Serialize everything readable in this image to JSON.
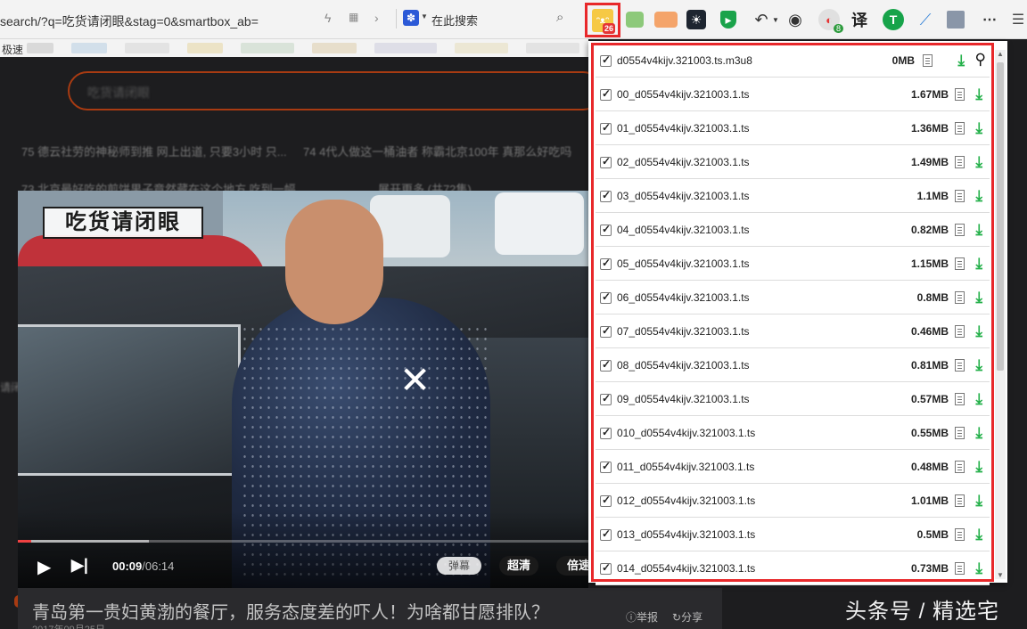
{
  "browser": {
    "url": "search/?q=吃货请闭眼&stag=0&smartbox_ab=",
    "search_placeholder": "在此搜索",
    "bookmark_label": "极速",
    "extension_badge": "26",
    "translate_label": "译",
    "extension_mail_badge": "8"
  },
  "page": {
    "search_value": "吃货请闭眼",
    "news": [
      "75 德云社劳的神秘师到推 网上出道, 只要3小时 只...",
      "74 4代人做这一桶油者 称霸北京100年 真那么好吃吗",
      "73 北京最好吃的煎饼果子竟然藏在这个地方 吃到一幅",
      "展开更多 (共72集)"
    ],
    "side_text": "请闭"
  },
  "video": {
    "logo_text": "吃货请闭眼",
    "current_time": "00:09",
    "duration": "/06:14",
    "played_fraction": 0.024,
    "buffered_fraction": 0.23,
    "danmu_label": "弹幕",
    "quality_label": "超清",
    "speed_label": "倍速"
  },
  "article": {
    "title": "青岛第一贵妇黄渤的餐厅，服务态度差的吓人！为啥都甘愿排队？",
    "date": "2017年09月25日",
    "report_label": "举报",
    "share_label": "分享"
  },
  "watermark": "头条号 / 精选宅",
  "popup": {
    "files": [
      {
        "name": "d0554v4kijv.321003.ts.m3u8",
        "size": "0MB"
      },
      {
        "name": "00_d0554v4kijv.321003.1.ts",
        "size": "1.67MB"
      },
      {
        "name": "01_d0554v4kijv.321003.1.ts",
        "size": "1.36MB"
      },
      {
        "name": "02_d0554v4kijv.321003.1.ts",
        "size": "1.49MB"
      },
      {
        "name": "03_d0554v4kijv.321003.1.ts",
        "size": "1.1MB"
      },
      {
        "name": "04_d0554v4kijv.321003.1.ts",
        "size": "0.82MB"
      },
      {
        "name": "05_d0554v4kijv.321003.1.ts",
        "size": "1.15MB"
      },
      {
        "name": "06_d0554v4kijv.321003.1.ts",
        "size": "0.8MB"
      },
      {
        "name": "07_d0554v4kijv.321003.1.ts",
        "size": "0.46MB"
      },
      {
        "name": "08_d0554v4kijv.321003.1.ts",
        "size": "0.81MB"
      },
      {
        "name": "09_d0554v4kijv.321003.1.ts",
        "size": "0.57MB"
      },
      {
        "name": "010_d0554v4kijv.321003.1.ts",
        "size": "0.55MB"
      },
      {
        "name": "011_d0554v4kijv.321003.1.ts",
        "size": "0.48MB"
      },
      {
        "name": "012_d0554v4kijv.321003.1.ts",
        "size": "1.01MB"
      },
      {
        "name": "013_d0554v4kijv.321003.1.ts",
        "size": "0.5MB"
      },
      {
        "name": "014_d0554v4kijv.321003.1.ts",
        "size": "0.73MB"
      }
    ]
  },
  "colors": {
    "highlight": "#e8282a",
    "download_green": "#24b04a",
    "accent_orange": "#a83b12"
  }
}
